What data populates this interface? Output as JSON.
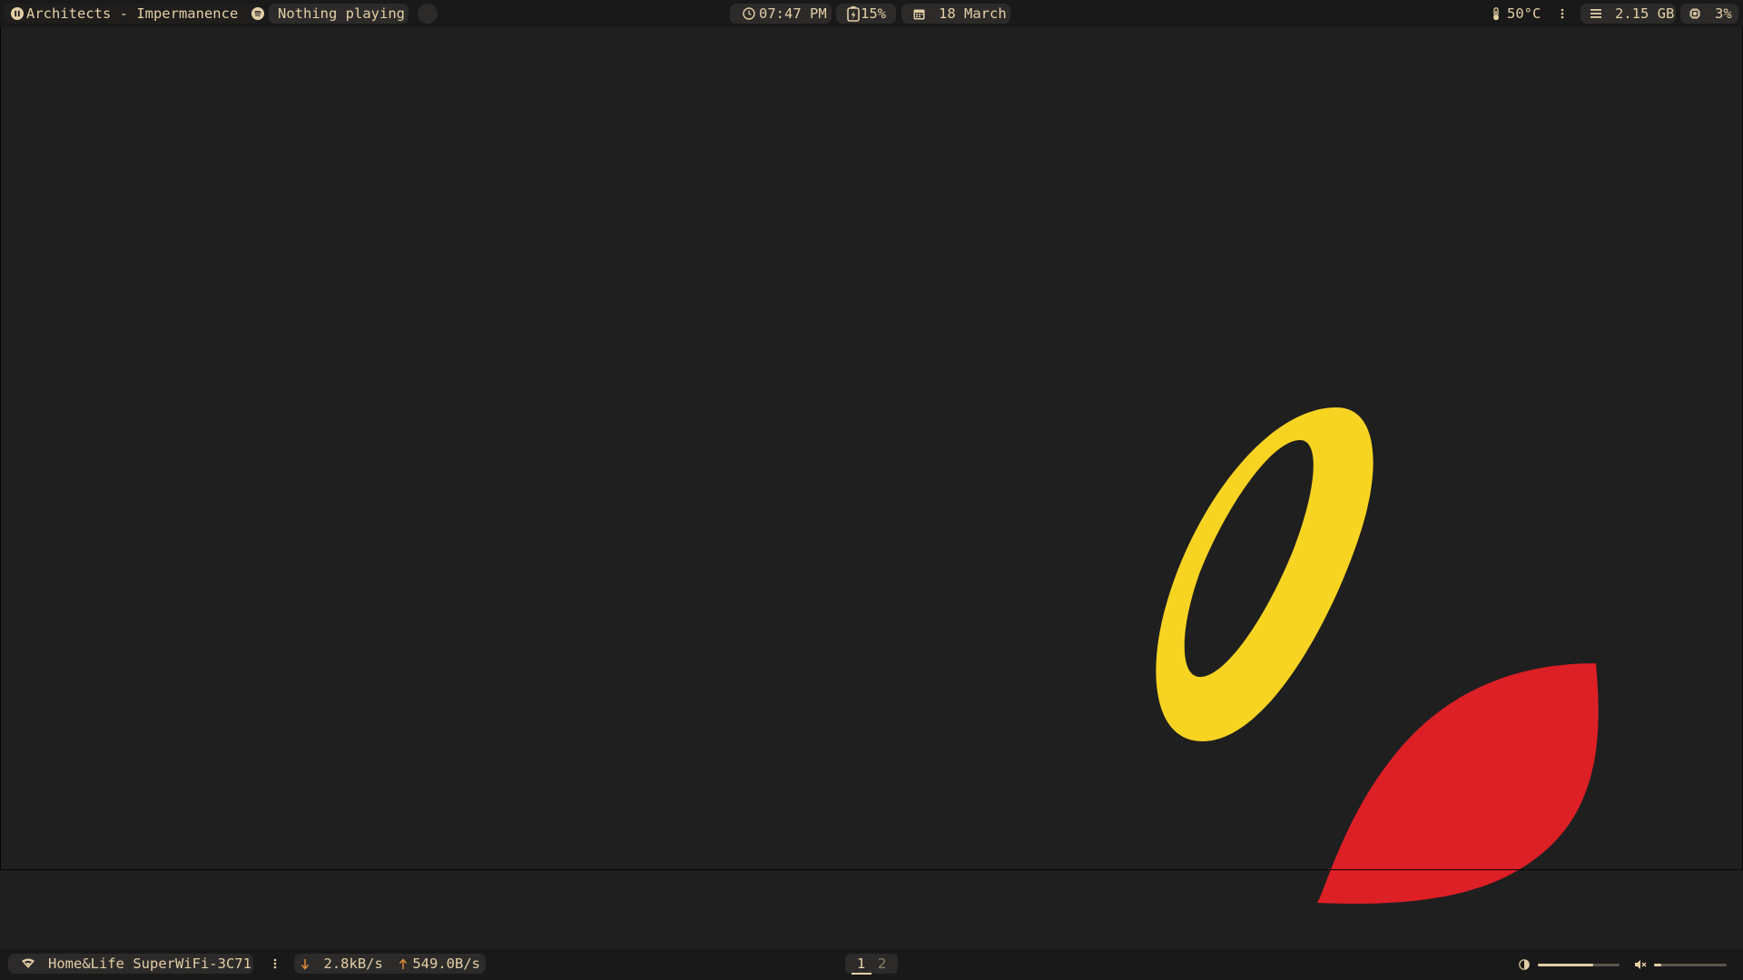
{
  "topbar": {
    "media": {
      "track": "Architects - Impermanence",
      "player_icon": "pause-icon"
    },
    "spotify": {
      "icon": "spotify-icon",
      "status": "Nothing playing"
    },
    "clock": {
      "icon": "clock-icon",
      "time": "07:47 PM"
    },
    "battery": {
      "icon": "battery-charging-icon",
      "percent": "15%",
      "level": 0.15
    },
    "date": {
      "icon": "calendar-icon",
      "text": "18 March"
    },
    "temperature": {
      "icon": "thermometer-icon",
      "value": "50°C"
    },
    "memory": {
      "icon": "memory-icon",
      "value": "2.15 GB"
    },
    "cpu": {
      "icon": "cpu-icon",
      "value": "3%"
    }
  },
  "bottombar": {
    "wifi": {
      "icon": "wifi-icon",
      "ssid": "Home&Life SuperWiFi-3C71"
    },
    "network": {
      "down_icon": "arrow-down-icon",
      "down": "2.8kB/s",
      "up_icon": "arrow-up-icon",
      "up": "549.0B/s"
    },
    "workspaces": [
      {
        "label": "1",
        "active": true
      },
      {
        "label": "2",
        "active": false
      }
    ],
    "brightness": {
      "icon": "brightness-icon",
      "level": 0.68
    },
    "volume": {
      "icon": "volume-mute-icon",
      "level": 0.1
    }
  },
  "colors": {
    "background": "#201f1f",
    "bar": "#1a1919",
    "pill": "#2d2b2a",
    "accent_text": "#e2cfa6",
    "network_arrow": "#d98b3a",
    "wallpaper_yellow": "#f7d422",
    "wallpaper_red": "#dd1f26"
  }
}
